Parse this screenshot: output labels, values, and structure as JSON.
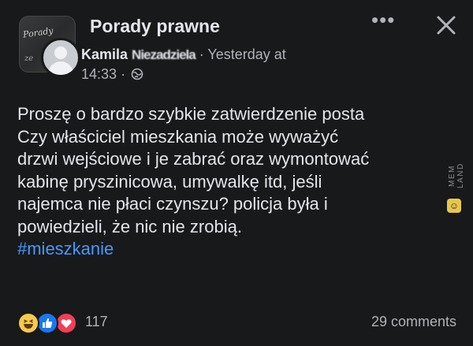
{
  "post": {
    "group_name": "Porady prawne",
    "group_avatar_text": "Porady",
    "group_avatar_text2": "ze",
    "author_first_name": "Kamila",
    "author_surname": "Niezadziela",
    "separator": "·",
    "timestamp_part1": "Yesterday at",
    "timestamp_part2": "14:33",
    "privacy_icon": "globe-icon",
    "more_label": "•••",
    "close_icon": "close-icon",
    "body_lines": [
      "Proszę o bardzo szybkie zatwierdzenie posta",
      "Czy właściciel mieszkania może wyważyć",
      "drzwi wejściowe i je zabrać oraz wymontować",
      "kabinę pryszinicowa, umywalkę itd, jeśli",
      "najemca nie płaci czynszu? policja była i",
      "powiedzieli, że nic nie zrobią."
    ],
    "hashtag": "#mieszkanie",
    "reactions": [
      "haha",
      "like",
      "love"
    ],
    "reaction_count": "117",
    "comments": "29 comments"
  },
  "watermark": {
    "text": "MEM LAND",
    "icon": "smiley-icon"
  },
  "colors": {
    "background": "#18191a",
    "text": "#e4e6eb",
    "secondary": "#b0b3b8",
    "hashtag": "#4599ff",
    "like": "#1877f2",
    "love": "#f33e58",
    "haha": "#f7c94d"
  }
}
